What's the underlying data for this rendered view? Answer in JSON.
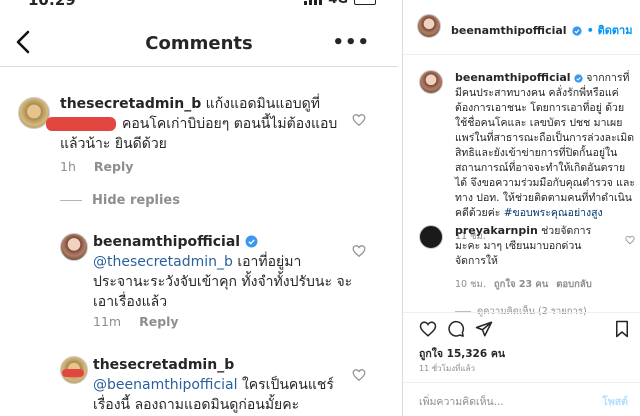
{
  "status_bar": {
    "time": "10:29",
    "network": "4G"
  },
  "header": {
    "title": "Comments",
    "more_label": "•••"
  },
  "comments": [
    {
      "username": "thesecretadmin_b",
      "text_line1": "แก้งแอดมินแอบดูที่",
      "text_line2": "คอนโคเก่าบิบ่อยๆ ตอนนี้ไม่ต้องแอบ",
      "text_line3": "แล้วน้าะ ยินดีด้วย",
      "time": "1h",
      "reply_label": "Reply"
    },
    {
      "hide_replies_label": "Hide replies"
    },
    {
      "username": "beenamthipofficial",
      "mention": "@thesecretadmin_b",
      "text_line1": "เอาที่อยู่มา",
      "text_line2": "ประจานะระวังจับเข้าคุก ทั้งจำทั้งปรับนะ จะ",
      "text_line3": "เอาเรื่องแล้ว",
      "time": "11m",
      "reply_label": "Reply"
    },
    {
      "username": "thesecretadmin_b",
      "mention": "@beenamthipofficial",
      "text_line1": "ใครเป็นคนแชร์",
      "text_line2": "เรื่องนี้ ลองถามแอดมินดูก่อนมั้ยคะ"
    }
  ],
  "panel": {
    "username": "beenamthipofficial",
    "follow_label": "• ติดตาม",
    "caption": "จากการที่มีคนประสาทบางคน คลั่งรักพี่หรือแค่ต้องการเอาชนะ โดยการเอาที่อยู่ ด้วยใช้ชื่อคนโคและ เลขบัตร ปชช มาเผยแพร่ในที่สาธารณะถือเป็นการล่วงละเมิดสิทธิและยังเข้าข่ายการที่ปิดกั้นอยู่ในสถานการณ์ที่อาจจะทำให้เกิดอันตรายได้ จึงขอความร่วมมือกับคุณตำรวจ และทาง ปอท. ให้ช่วยติดตามคนที่ทำดำเนินคดีด้วยค่ะ",
    "hashtag": "#ขอบพระคุณอย่างสูง",
    "caption_time": "11 ชม.",
    "comment": {
      "username": "preyakarnpin",
      "text": "ช่วยจัดการมะคะ มาๆ เซียนมาบอกด่วน จัดการให้",
      "time": "10 ชม.",
      "likes": "ถูกใจ 23 คน",
      "reply_label": "ตอบกลับ",
      "view_replies": "ดูความคิดเห็น (2 รายการ)"
    },
    "like_count": "ถูกใจ 15,326 คน",
    "post_time": "11 ชั่วโมงที่แล้ว",
    "add_comment_placeholder": "เพิ่มความคิดเห็น...",
    "post_label": "โพสต์"
  },
  "colors": {
    "link": "#2a5f9e",
    "follow": "#0095f6",
    "muted": "#8e8e8e",
    "redaction": "#e1473f"
  },
  "icons": [
    "back-chevron-icon",
    "more-icon",
    "heart-icon",
    "verified-icon",
    "comment-icon",
    "share-icon",
    "bookmark-icon"
  ]
}
